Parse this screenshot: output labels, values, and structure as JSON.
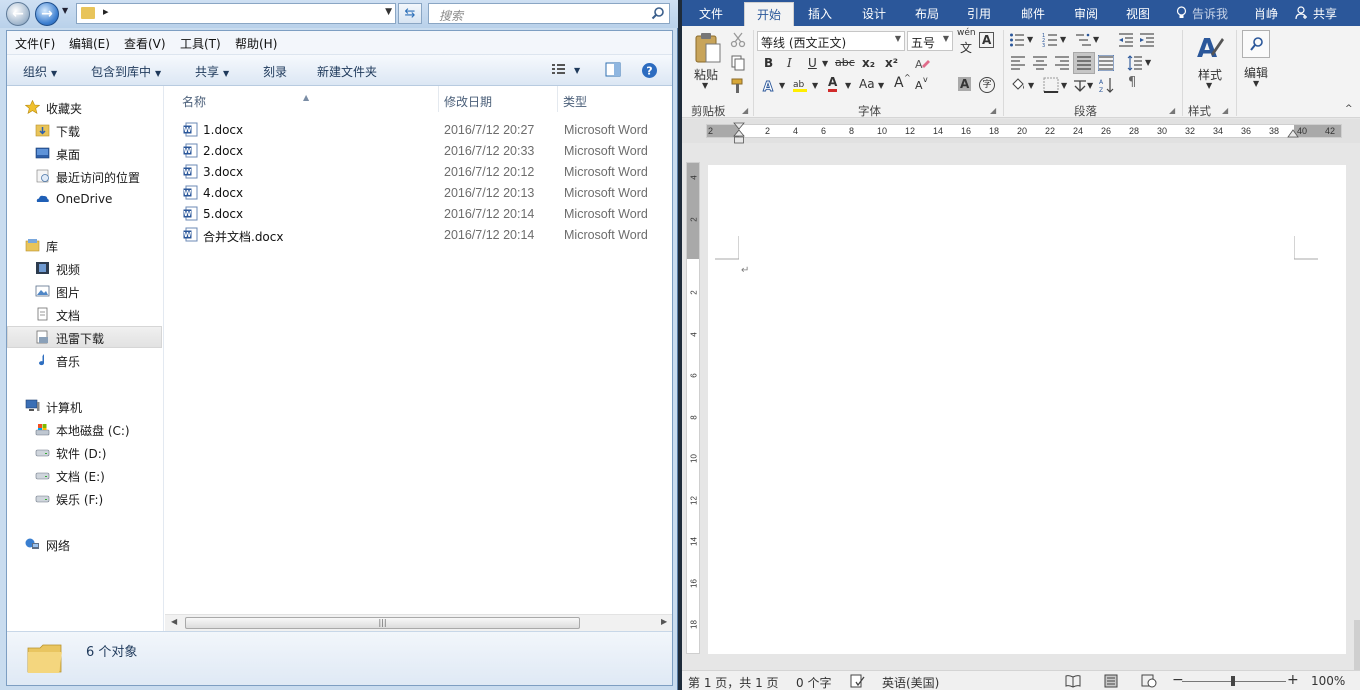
{
  "explorer": {
    "search_placeholder": "搜索",
    "menu": [
      "文件(F)",
      "编辑(E)",
      "查看(V)",
      "工具(T)",
      "帮助(H)"
    ],
    "toolbar": {
      "organize": "组织",
      "include_library": "包含到库中",
      "share": "共享",
      "burn": "刻录",
      "new_folder": "新建文件夹"
    },
    "nav": {
      "favorites": "收藏夹",
      "downloads": "下载",
      "desktop": "桌面",
      "recent": "最近访问的位置",
      "onedrive": "OneDrive",
      "libraries": "库",
      "videos": "视频",
      "pictures": "图片",
      "documents": "文档",
      "xunlei": "迅雷下载",
      "music": "音乐",
      "computer": "计算机",
      "drive_c": "本地磁盘 (C:)",
      "drive_d": "软件 (D:)",
      "drive_e": "文档 (E:)",
      "drive_f": "娱乐 (F:)",
      "network": "网络"
    },
    "columns": {
      "name": "名称",
      "date": "修改日期",
      "type": "类型"
    },
    "files": [
      {
        "name": "1.docx",
        "date": "2016/7/12 20:27",
        "type": "Microsoft Word"
      },
      {
        "name": "2.docx",
        "date": "2016/7/12 20:33",
        "type": "Microsoft Word"
      },
      {
        "name": "3.docx",
        "date": "2016/7/12 20:12",
        "type": "Microsoft Word"
      },
      {
        "name": "4.docx",
        "date": "2016/7/12 20:13",
        "type": "Microsoft Word"
      },
      {
        "name": "5.docx",
        "date": "2016/7/12 20:14",
        "type": "Microsoft Word"
      },
      {
        "name": "合并文档.docx",
        "date": "2016/7/12 20:14",
        "type": "Microsoft Word"
      }
    ],
    "status_count": "6 个对象"
  },
  "word": {
    "tabs": [
      "文件",
      "开始",
      "插入",
      "设计",
      "布局",
      "引用",
      "邮件",
      "审阅",
      "视图"
    ],
    "tell_me": "告诉我",
    "user": "肖峥",
    "share": "共享",
    "clipboard": {
      "paste": "粘贴",
      "label": "剪贴板"
    },
    "font": {
      "name": "等线 (西文正文)",
      "size": "五号",
      "wen": "wén",
      "wen_char": "文",
      "a_box": "A",
      "bold": "B",
      "italic": "I",
      "underline": "U",
      "strike": "abc",
      "sub": "x₂",
      "sup": "x²",
      "case": "Aa",
      "grow": "A",
      "shrink": "A",
      "font_color": "A",
      "char_shade": "A",
      "enclose": "字",
      "label": "字体"
    },
    "paragraph": {
      "label": "段落"
    },
    "styles": {
      "label": "样式",
      "button": "样式"
    },
    "editing": {
      "button": "编辑"
    },
    "ruler_h": [
      "2",
      "2",
      "4",
      "6",
      "8",
      "10",
      "12",
      "14",
      "16",
      "18",
      "20",
      "22",
      "24",
      "26",
      "28",
      "30",
      "32",
      "34",
      "36",
      "38",
      "40",
      "42"
    ],
    "ruler_v": [
      "4",
      "2",
      "2",
      "4",
      "6",
      "8",
      "10",
      "12",
      "14",
      "16",
      "18"
    ],
    "ruler_corner": "L",
    "para_mark": "↵",
    "status": {
      "page": "第 1 页，共 1 页",
      "words": "0 个字",
      "lang": "英语(美国)",
      "minus": "−",
      "plus": "+",
      "zoom": "100%"
    }
  }
}
